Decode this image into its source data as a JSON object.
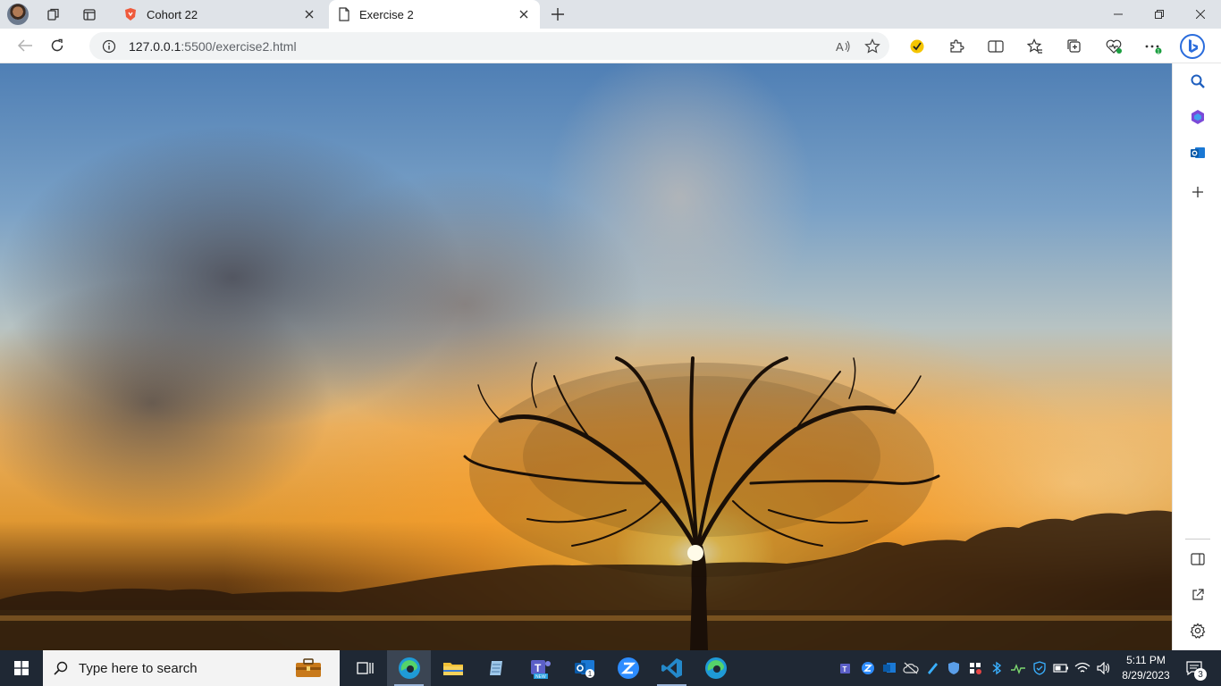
{
  "tabs": [
    {
      "title": "Cohort 22",
      "favicon": "brave-shield-icon",
      "active": false
    },
    {
      "title": "Exercise 2",
      "favicon": "page-icon",
      "active": true
    }
  ],
  "addressbar": {
    "url_host": "127.0.0.1",
    "url_rest": ":5500/exercise2.html"
  },
  "content": {
    "image_description_icon": "sunset-tree-photo"
  },
  "taskbar": {
    "search_placeholder": "Type here to search",
    "clock_time": "5:11 PM",
    "clock_date": "8/29/2023",
    "notification_count": "3"
  },
  "colors": {
    "taskbar_bg": "#1f2834",
    "tab_strip_bg": "#dfe3e8",
    "accent": "#0078d4"
  }
}
